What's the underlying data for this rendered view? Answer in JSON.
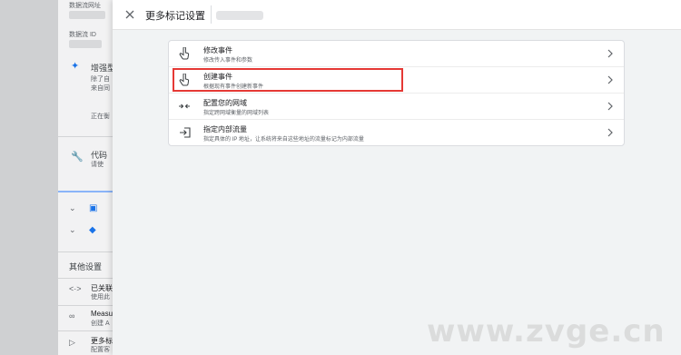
{
  "background": {
    "data_stream_url_label": "数据流网址",
    "data_stream_id_label": "数据流 ID",
    "enhanced_measurement_label": "增强型",
    "enhanced_desc_1": "除了自",
    "enhanced_desc_2": "来自同",
    "enhanced_status": "正在衡",
    "code_label": "代码",
    "code_desc": "请使",
    "other_settings_label": "其他设置",
    "linked_label": "已关联",
    "linked_desc": "使用此",
    "measurement_label": "Measu",
    "measurement_desc": "创建 A",
    "more_tag_label": "更多标",
    "more_tag_desc": "配置客"
  },
  "drawer": {
    "title": "更多标记设置",
    "rows": [
      {
        "icon": "touch-icon",
        "title": "修改事件",
        "desc": "修改传入事件和参数"
      },
      {
        "icon": "touch-icon",
        "title": "创建事件",
        "desc": "根据现有事件创建新事件"
      },
      {
        "icon": "compress-arrows-icon",
        "title": "配置您的网域",
        "desc": "指定跨网域衡量的网域列表"
      },
      {
        "icon": "login-icon",
        "title": "指定内部流量",
        "desc": "指定具体的 IP 地址，让系统将来自这些地址的流量标记为内部流量"
      }
    ]
  },
  "watermark": "www.zvge.cn",
  "colors": {
    "highlight": "#e53935",
    "accent": "#1a73e8"
  }
}
